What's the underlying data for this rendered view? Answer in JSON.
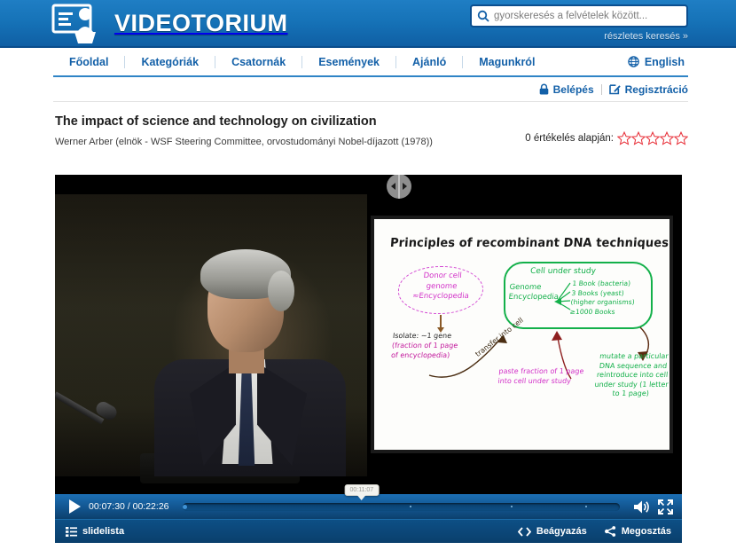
{
  "header": {
    "brand": "VIDEOTORIUM",
    "logo_icon": "lectern-presenter-icon",
    "search": {
      "icon": "search-icon",
      "placeholder": "gyorskeresés a felvételek között...",
      "value": ""
    },
    "advanced_search": "részletes keresés »"
  },
  "nav": {
    "items": [
      {
        "label": "Főoldal"
      },
      {
        "label": "Kategóriák"
      },
      {
        "label": "Csatornák"
      },
      {
        "label": "Események"
      },
      {
        "label": "Ajánló"
      },
      {
        "label": "Magunkról"
      }
    ],
    "language": {
      "label": "English",
      "icon": "globe-icon"
    }
  },
  "account": {
    "login": {
      "label": "Belépés",
      "icon": "lock-icon"
    },
    "register": {
      "label": "Regisztráció",
      "icon": "pencil-square-icon"
    }
  },
  "video": {
    "title": "The impact of science and technology on civilization",
    "subtitle": "Werner Arber (elnök - WSF Steering Committee, orvostudományi Nobel-díjazott (1978))",
    "rating_label": "0 értékelés alapján:",
    "rating_stars": 5,
    "rating_filled": 0,
    "star_color": "#e8313a"
  },
  "player": {
    "splitter_icon": "split-handle-icon",
    "play_icon": "play-icon",
    "time_current": "00:07:30",
    "time_total": "00:22:26",
    "time_display": "00:07:30 / 00:22:26",
    "progress_percent": 0,
    "scrub_tooltip": "00:11:07",
    "volume_icon": "volume-icon",
    "fullscreen_icon": "fullscreen-icon",
    "slidelist": {
      "label": "slidelista",
      "icon": "list-icon"
    },
    "embed": {
      "label": "Beágyazás",
      "icon": "code-brackets-icon"
    },
    "share": {
      "label": "Megosztás",
      "icon": "share-icon"
    }
  },
  "slide": {
    "title": "Principles of recombinant DNA techniques",
    "donor_bubble": "Donor cell genome ≈Encyclopedia",
    "isolate_line1": "Isolate: ~1 gene",
    "isolate_line2": "(fraction of 1 page",
    "isolate_line3": "of encyclopedia)",
    "transfer_label": "transfer into cell",
    "paste_text": "paste fraction of 1 page into cell under study",
    "cell_title": "Cell under study",
    "genome_label": "Genome Encyclopedia",
    "books_line1": "1 Book (bacteria)",
    "books_line2": "3 Books (yeast)",
    "books_line3": "(higher organisms)",
    "books_line4": "≥1000 Books",
    "mutate_text": "mutate a particular DNA sequence and reintroduce into cell under study (1 letter to 1 page)"
  },
  "colors": {
    "header_blue": "#1673b8",
    "nav_blue": "#1360a8",
    "accent_green": "#13b04a",
    "accent_magenta": "#d230c8"
  }
}
